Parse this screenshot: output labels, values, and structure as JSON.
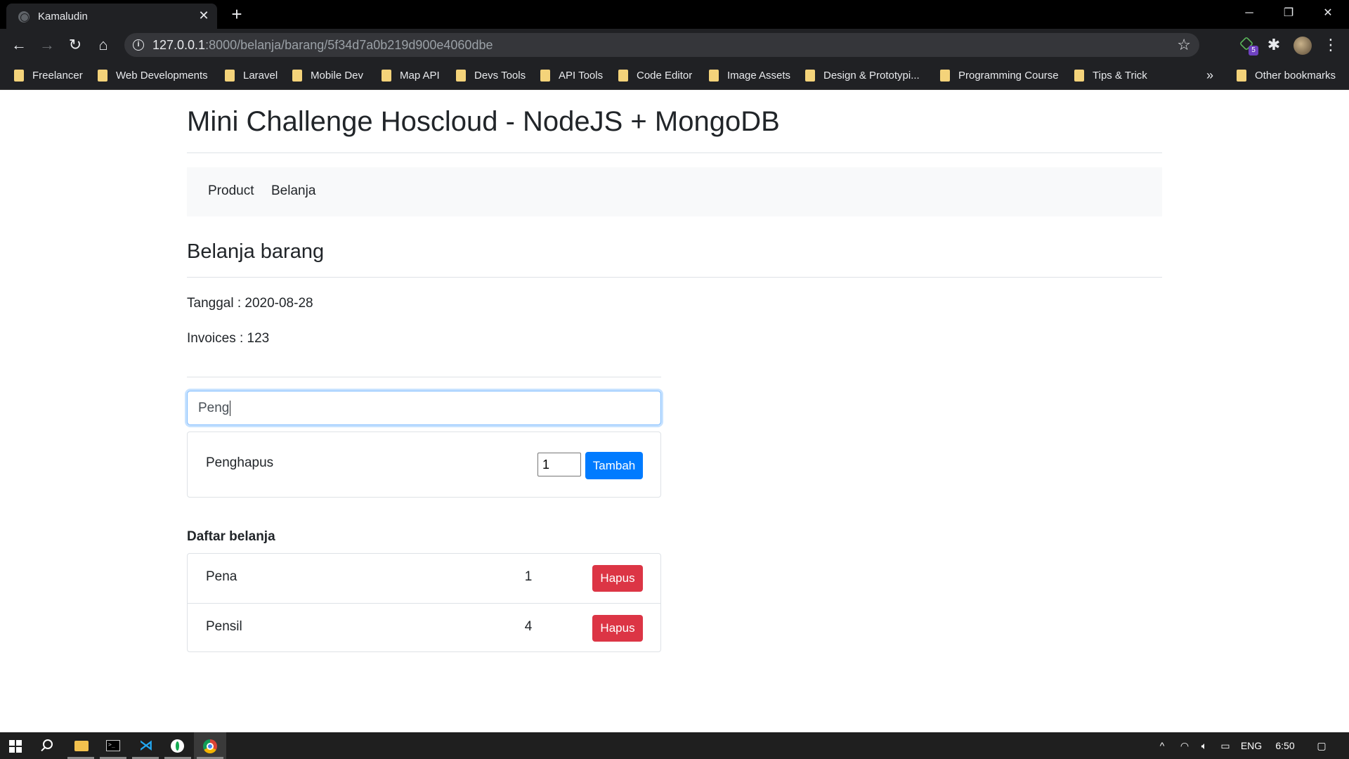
{
  "browser": {
    "tab_title": "Kamaludin",
    "url_host": "127.0.0.1",
    "url_rest": ":8000/belanja/barang/5f34d7a0b219d900e4060dbe",
    "extension_badge": "5",
    "bookmarks": [
      "Freelancer",
      "Web Developments",
      "Laravel",
      "Mobile Dev",
      "Map API",
      "Devs Tools",
      "API Tools",
      "Code Editor",
      "Image Assets",
      "Design & Prototypi...",
      "Programming Course",
      "Tips & Trick"
    ],
    "bookmarks_more": "»",
    "other_bookmarks": "Other bookmarks"
  },
  "page": {
    "title": "Mini Challenge Hoscloud - NodeJS + MongoDB",
    "nav": [
      "Product",
      "Belanja"
    ],
    "section_title": "Belanja barang",
    "date_line": "Tanggal : 2020-08-28",
    "invoice_line": "Invoices : 123",
    "search_value": "Peng",
    "search_result": {
      "name": "Penghapus",
      "qty_value": "1",
      "add_label": "Tambah"
    },
    "list_title": "Daftar belanja",
    "cart": [
      {
        "name": "Pena",
        "qty": "1",
        "remove_label": "Hapus"
      },
      {
        "name": "Pensil",
        "qty": "4",
        "remove_label": "Hapus"
      }
    ]
  },
  "taskbar": {
    "language": "ENG",
    "time": "6:50"
  },
  "colors": {
    "primary": "#007bff",
    "danger": "#dc3545",
    "navbar_bg": "#f8f9fa",
    "chrome_dark": "#202124"
  }
}
